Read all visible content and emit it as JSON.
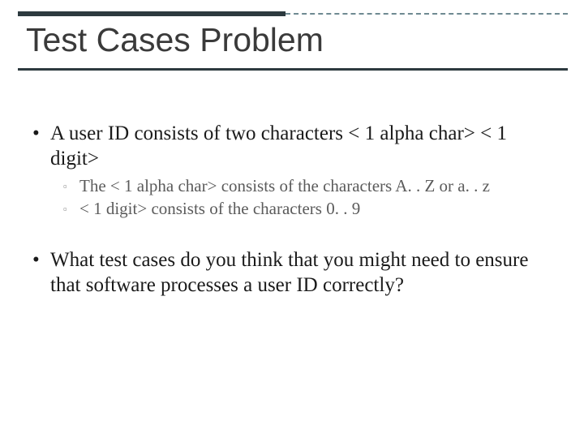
{
  "title": "Test Cases Problem",
  "bullets": {
    "b1": "A user ID consists of two characters < 1 alpha char> < 1 digit>",
    "b1a": "The < 1 alpha char> consists of the characters A. . Z or a. . z",
    "b1b": "< 1 digit> consists of the characters 0. . 9",
    "b2": "What test cases do you think that you might need to ensure that software processes a user ID correctly?"
  }
}
